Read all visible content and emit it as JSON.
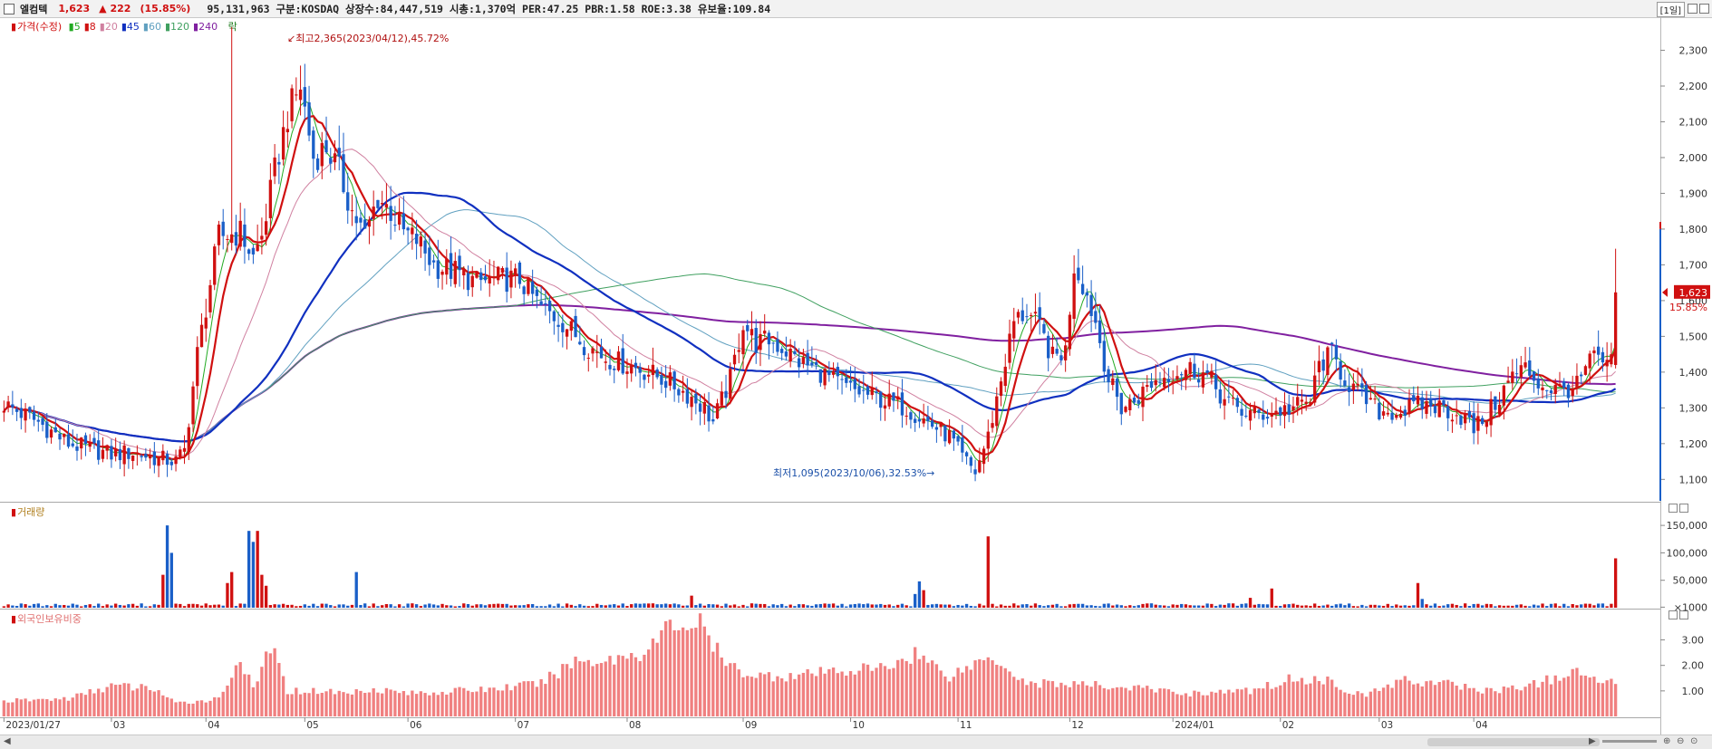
{
  "header": {
    "name": "엘컴텍",
    "price": "1,623",
    "change": "▲ 222",
    "change_pct": "(15.85%)",
    "info": "95,131,963  구분:KOSDAQ 상장수:84,447,519 시총:1,370억 PER:47.25 PBR:1.58 ROE:3.38 유보율:109.84",
    "period": "[1일]"
  },
  "legend_price": {
    "label": "가격(수정)",
    "ma": [
      {
        "label": "5",
        "color": "#22aa22"
      },
      {
        "label": "8",
        "color": "#d01010"
      },
      {
        "label": "20",
        "color": "#d080a0"
      },
      {
        "label": "45",
        "color": "#1030c0"
      },
      {
        "label": "60",
        "color": "#60a0c0"
      },
      {
        "label": "120",
        "color": "#40a060"
      },
      {
        "label": "240",
        "color": "#8020a0"
      }
    ],
    "extra": "락"
  },
  "legend_volume": {
    "label": "거래량"
  },
  "legend_foreign": {
    "label": "외국인보유비중"
  },
  "annotations": {
    "high": "최고2,365(2023/04/12),45.72%",
    "low": "최저1,095(2023/10/06),32.53%"
  },
  "current_price_tag": {
    "price": "1,623",
    "pct": "15.85%"
  },
  "colors": {
    "up": "#d01010",
    "down": "#1a5fc8",
    "foreign": "#f08080"
  },
  "chart_data": [
    {
      "type": "candlestick",
      "title": "가격(수정)",
      "ylim": [
        1040,
        2390
      ],
      "y_ticks": [
        1100,
        1200,
        1300,
        1400,
        1500,
        1600,
        1700,
        1800,
        1900,
        2000,
        2100,
        2200,
        2300
      ],
      "y_tick_labels": [
        "1,100",
        "1,200",
        "1,300",
        "1,400",
        "1,500",
        "1,600",
        "1,700",
        "1,800",
        "1,900",
        "2,000",
        "2,100",
        "2,200",
        "2,300"
      ],
      "x_ticks": [
        "2023/01/27",
        "03",
        "04",
        "05",
        "06",
        "07",
        "08",
        "09",
        "10",
        "11",
        "12",
        "2024/01",
        "02",
        "03",
        "04"
      ],
      "close_anchors": [
        [
          0,
          1310
        ],
        [
          8,
          1260
        ],
        [
          15,
          1200
        ],
        [
          25,
          1170
        ],
        [
          30,
          1175
        ],
        [
          35,
          1160
        ],
        [
          40,
          1150
        ],
        [
          42,
          1180
        ],
        [
          45,
          1450
        ],
        [
          50,
          1780
        ],
        [
          55,
          1790
        ],
        [
          58,
          1720
        ],
        [
          60,
          1780
        ],
        [
          63,
          1960
        ],
        [
          66,
          2120
        ],
        [
          69,
          2200
        ],
        [
          72,
          2000
        ],
        [
          75,
          2030
        ],
        [
          78,
          1960
        ],
        [
          81,
          1850
        ],
        [
          84,
          1780
        ],
        [
          87,
          1890
        ],
        [
          90,
          1850
        ],
        [
          93,
          1790
        ],
        [
          96,
          1770
        ],
        [
          100,
          1700
        ],
        [
          105,
          1680
        ],
        [
          110,
          1650
        ],
        [
          115,
          1660
        ],
        [
          120,
          1660
        ],
        [
          125,
          1580
        ],
        [
          130,
          1540
        ],
        [
          135,
          1480
        ],
        [
          140,
          1440
        ],
        [
          145,
          1420
        ],
        [
          150,
          1400
        ],
        [
          155,
          1370
        ],
        [
          160,
          1330
        ],
        [
          163,
          1300
        ],
        [
          165,
          1260
        ],
        [
          169,
          1380
        ],
        [
          172,
          1540
        ],
        [
          175,
          1480
        ],
        [
          178,
          1490
        ],
        [
          182,
          1460
        ],
        [
          185,
          1430
        ],
        [
          190,
          1400
        ],
        [
          195,
          1360
        ],
        [
          200,
          1340
        ],
        [
          205,
          1320
        ],
        [
          210,
          1300
        ],
        [
          215,
          1260
        ],
        [
          220,
          1220
        ],
        [
          223,
          1160
        ],
        [
          226,
          1120
        ],
        [
          229,
          1220
        ],
        [
          232,
          1380
        ],
        [
          235,
          1540
        ],
        [
          238,
          1570
        ],
        [
          241,
          1520
        ],
        [
          244,
          1440
        ],
        [
          247,
          1460
        ],
        [
          249,
          1700
        ],
        [
          251,
          1650
        ],
        [
          254,
          1540
        ],
        [
          257,
          1380
        ],
        [
          260,
          1300
        ],
        [
          263,
          1320
        ],
        [
          267,
          1370
        ],
        [
          272,
          1400
        ],
        [
          276,
          1410
        ],
        [
          280,
          1390
        ],
        [
          284,
          1320
        ],
        [
          288,
          1290
        ],
        [
          292,
          1280
        ],
        [
          296,
          1290
        ],
        [
          300,
          1300
        ],
        [
          304,
          1320
        ],
        [
          306,
          1420
        ],
        [
          309,
          1450
        ],
        [
          312,
          1380
        ],
        [
          316,
          1330
        ],
        [
          320,
          1290
        ],
        [
          325,
          1290
        ],
        [
          330,
          1310
        ],
        [
          335,
          1300
        ],
        [
          340,
          1270
        ],
        [
          342,
          1240
        ],
        [
          345,
          1280
        ],
        [
          348,
          1330
        ],
        [
          351,
          1390
        ],
        [
          354,
          1410
        ],
        [
          358,
          1360
        ],
        [
          362,
          1350
        ],
        [
          366,
          1360
        ],
        [
          369,
          1430
        ],
        [
          371,
          1440
        ],
        [
          373,
          1410
        ],
        [
          374,
          1420
        ],
        [
          375,
          1623
        ]
      ],
      "high": {
        "date": "2023/04/12",
        "value": 2365
      },
      "low": {
        "date": "2023/10/06",
        "value": 1095
      },
      "last_close": 1623
    },
    {
      "type": "bar",
      "title": "거래량",
      "ylim": [
        0,
        170000
      ],
      "y_ticks": [
        1000,
        50000,
        100000,
        150000
      ],
      "y_tick_labels": [
        "×1000",
        "50,000",
        "100,000",
        "150,000"
      ],
      "spikes": [
        [
          37,
          60000
        ],
        [
          38,
          150000
        ],
        [
          39,
          100000
        ],
        [
          52,
          45000
        ],
        [
          53,
          65000
        ],
        [
          57,
          140000
        ],
        [
          58,
          120000
        ],
        [
          59,
          140000
        ],
        [
          60,
          60000
        ],
        [
          61,
          40000
        ],
        [
          82,
          65000
        ],
        [
          160,
          22000
        ],
        [
          212,
          25000
        ],
        [
          213,
          48000
        ],
        [
          214,
          32000
        ],
        [
          229,
          130000
        ],
        [
          290,
          18000
        ],
        [
          295,
          35000
        ],
        [
          329,
          45000
        ],
        [
          330,
          16000
        ],
        [
          375,
          90000
        ]
      ],
      "baseline": 4000
    },
    {
      "type": "bar",
      "title": "외국인보유비중",
      "ylim": [
        0,
        3.8
      ],
      "y_ticks": [
        1.0,
        2.0,
        3.0
      ],
      "y_tick_labels": [
        "1.00",
        "2.00",
        "3.00"
      ],
      "anchors": [
        [
          0,
          0.6
        ],
        [
          15,
          0.7
        ],
        [
          25,
          1.2
        ],
        [
          35,
          1.1
        ],
        [
          40,
          0.5
        ],
        [
          50,
          0.7
        ],
        [
          55,
          2.3
        ],
        [
          58,
          1.0
        ],
        [
          62,
          2.8
        ],
        [
          66,
          1.0
        ],
        [
          75,
          1.0
        ],
        [
          80,
          0.9
        ],
        [
          85,
          1.1
        ],
        [
          95,
          0.9
        ],
        [
          105,
          1.0
        ],
        [
          115,
          1.1
        ],
        [
          125,
          1.3
        ],
        [
          133,
          2.2
        ],
        [
          140,
          2.2
        ],
        [
          150,
          2.6
        ],
        [
          155,
          3.6
        ],
        [
          162,
          3.6
        ],
        [
          168,
          2.0
        ],
        [
          175,
          1.6
        ],
        [
          185,
          1.6
        ],
        [
          195,
          1.8
        ],
        [
          205,
          1.9
        ],
        [
          212,
          2.5
        ],
        [
          220,
          1.6
        ],
        [
          230,
          2.4
        ],
        [
          238,
          1.3
        ],
        [
          245,
          1.3
        ],
        [
          255,
          1.2
        ],
        [
          265,
          1.1
        ],
        [
          275,
          0.9
        ],
        [
          290,
          1.0
        ],
        [
          300,
          1.5
        ],
        [
          308,
          1.4
        ],
        [
          316,
          0.8
        ],
        [
          325,
          1.4
        ],
        [
          335,
          1.3
        ],
        [
          345,
          1.0
        ],
        [
          355,
          1.2
        ],
        [
          365,
          1.7
        ],
        [
          375,
          1.3
        ]
      ]
    }
  ],
  "scroll": {
    "left_arrow": "◀",
    "right_arrow": "▶"
  }
}
